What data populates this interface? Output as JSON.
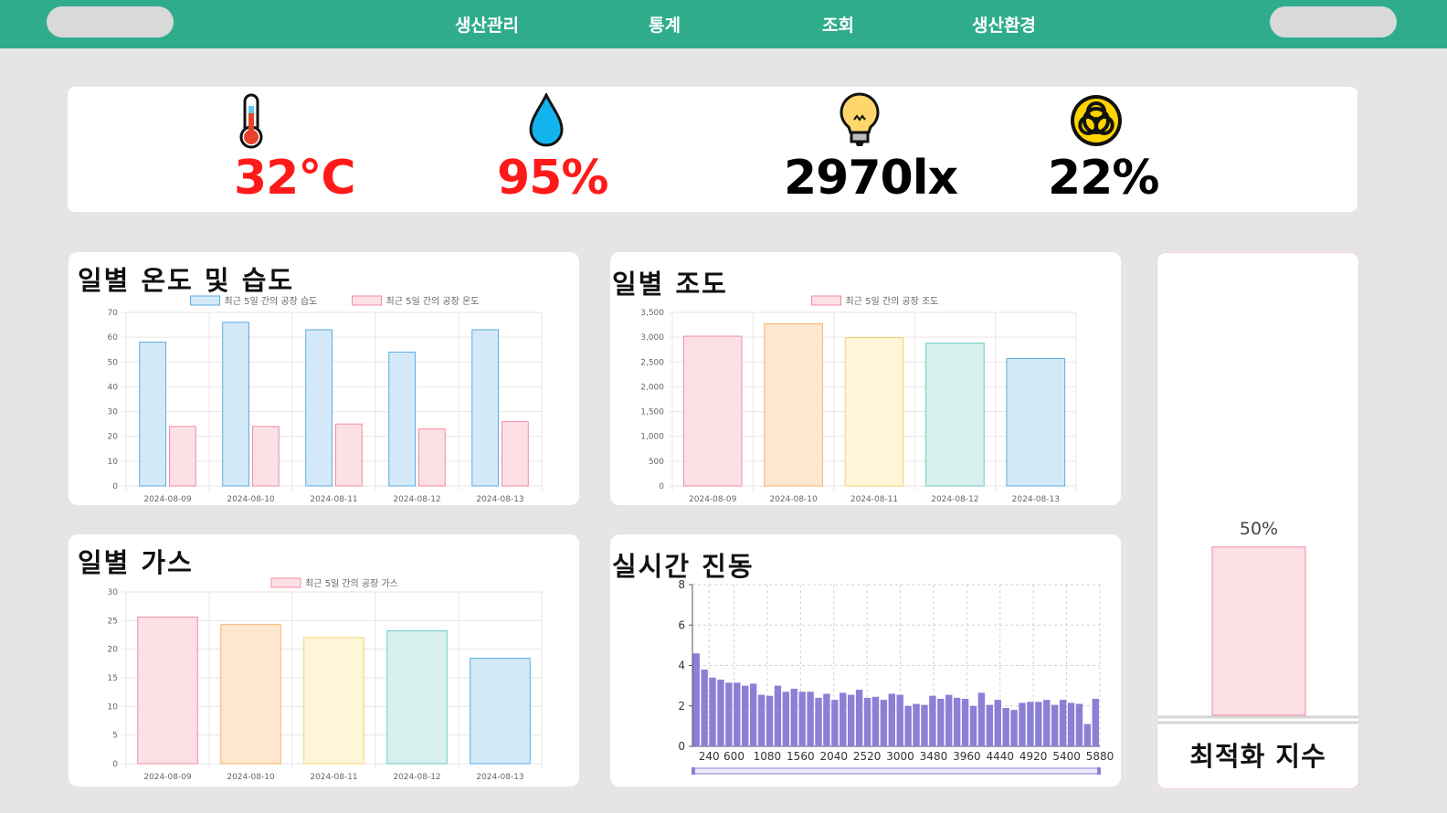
{
  "nav": {
    "items": [
      "생산관리",
      "통계",
      "조회",
      "생산환경"
    ]
  },
  "metrics": {
    "temperature": {
      "value": "32°C",
      "icon": "thermometer-icon",
      "color": "#ff1a1a"
    },
    "humidity": {
      "value": "95%",
      "icon": "water-drop-icon",
      "color": "#ff1a1a"
    },
    "illuminance": {
      "value": "2970lx",
      "icon": "light-bulb-icon",
      "color": "#000000"
    },
    "gas": {
      "value": "22%",
      "icon": "biohazard-icon",
      "color": "#000000"
    }
  },
  "charts": {
    "temp_humidity": {
      "title": "일별 온도 및 습도"
    },
    "illuminance": {
      "title": "일별 조도"
    },
    "gas": {
      "title": "일별 가스"
    },
    "vibration": {
      "title": "실시간 진동"
    },
    "optimization": {
      "title": "최적화 지수"
    }
  },
  "chart_data": [
    {
      "id": "temp_humidity",
      "type": "bar",
      "categories": [
        "2024-08-09",
        "2024-08-10",
        "2024-08-11",
        "2024-08-12",
        "2024-08-13"
      ],
      "series": [
        {
          "name": "최근 5일 간의 공장 습도",
          "values": [
            58,
            66,
            63,
            54,
            63
          ],
          "fill": "#d4e9f8",
          "stroke": "#5aaee3"
        },
        {
          "name": "최근 5일 간의 공장 온도",
          "values": [
            24,
            24,
            25,
            23,
            26
          ],
          "fill": "#fde0e6",
          "stroke": "#f08ca0"
        }
      ],
      "yticks": [
        "0",
        "10",
        "20",
        "30",
        "40",
        "50",
        "60",
        "70"
      ],
      "ylim": [
        0,
        70
      ],
      "grid": true,
      "legend": "top"
    },
    {
      "id": "illuminance",
      "type": "bar",
      "categories": [
        "2024-08-09",
        "2024-08-10",
        "2024-08-11",
        "2024-08-12",
        "2024-08-13"
      ],
      "series": [
        {
          "name": "최근 5일 간의 공장 조도",
          "values": [
            3020,
            3270,
            2990,
            2880,
            2570
          ],
          "fill": "#fde0e6",
          "stroke": "#f08ca0"
        }
      ],
      "bar_colors": [
        {
          "fill": "#fde0e6",
          "stroke": "#f08ca0"
        },
        {
          "fill": "#ffe7cf",
          "stroke": "#f6b26b"
        },
        {
          "fill": "#fff5d9",
          "stroke": "#f5d36f"
        },
        {
          "fill": "#d8f1ef",
          "stroke": "#6ccbc3"
        },
        {
          "fill": "#d4e9f8",
          "stroke": "#5aaee3"
        }
      ],
      "yticks": [
        "0",
        "500",
        "1,000",
        "1,500",
        "2,000",
        "2,500",
        "3,000",
        "3,500"
      ],
      "ylim": [
        0,
        3500
      ],
      "grid": true,
      "legend": "top"
    },
    {
      "id": "gas",
      "type": "bar",
      "categories": [
        "2024-08-09",
        "2024-08-10",
        "2024-08-11",
        "2024-08-12",
        "2024-08-13"
      ],
      "series": [
        {
          "name": "최근 5일 간의 공장 가스",
          "values": [
            25.6,
            24.3,
            22,
            23.2,
            18.4
          ],
          "fill": "#fde0e6",
          "stroke": "#f08ca0"
        }
      ],
      "bar_colors": [
        {
          "fill": "#fde0e6",
          "stroke": "#f08ca0"
        },
        {
          "fill": "#ffe7cf",
          "stroke": "#f6b26b"
        },
        {
          "fill": "#fff5d9",
          "stroke": "#f5d36f"
        },
        {
          "fill": "#d8f1ef",
          "stroke": "#6ccbc3"
        },
        {
          "fill": "#d4e9f8",
          "stroke": "#5aaee3"
        }
      ],
      "yticks": [
        "0",
        "5",
        "10",
        "15",
        "20",
        "25",
        "30"
      ],
      "ylim": [
        0,
        30
      ],
      "grid": true,
      "legend": "top"
    },
    {
      "id": "vibration",
      "type": "bar",
      "x_ticks": [
        "240",
        "600",
        "1080",
        "1560",
        "2040",
        "2520",
        "3000",
        "3480",
        "3960",
        "4440",
        "4920",
        "5400",
        "5880"
      ],
      "x_tick_values": [
        240,
        600,
        1080,
        1560,
        2040,
        2520,
        3000,
        3480,
        3960,
        4440,
        4920,
        5400,
        5880
      ],
      "xlim": [
        0,
        5880
      ],
      "values": [
        4.6,
        3.8,
        3.4,
        3.3,
        3.15,
        3.15,
        3.0,
        3.1,
        2.55,
        2.5,
        3.0,
        2.7,
        2.85,
        2.7,
        2.7,
        2.4,
        2.6,
        2.3,
        2.65,
        2.55,
        2.8,
        2.4,
        2.45,
        2.3,
        2.6,
        2.55,
        2.0,
        2.1,
        2.05,
        2.5,
        2.35,
        2.55,
        2.4,
        2.35,
        2.0,
        2.65,
        2.05,
        2.3,
        1.9,
        1.8,
        2.15,
        2.2,
        2.2,
        2.3,
        2.05,
        2.3,
        2.15,
        2.1,
        1.1,
        2.35
      ],
      "yticks": [
        "0",
        "2",
        "4",
        "6",
        "8"
      ],
      "ylim": [
        0,
        8
      ],
      "bar_color": "#8b80d6",
      "grid": true
    },
    {
      "id": "optimization",
      "type": "bar",
      "values": [
        50
      ],
      "label": "50%",
      "ylim": [
        0,
        100
      ],
      "fill": "#fde0e6",
      "stroke": "#f08ca0"
    }
  ]
}
